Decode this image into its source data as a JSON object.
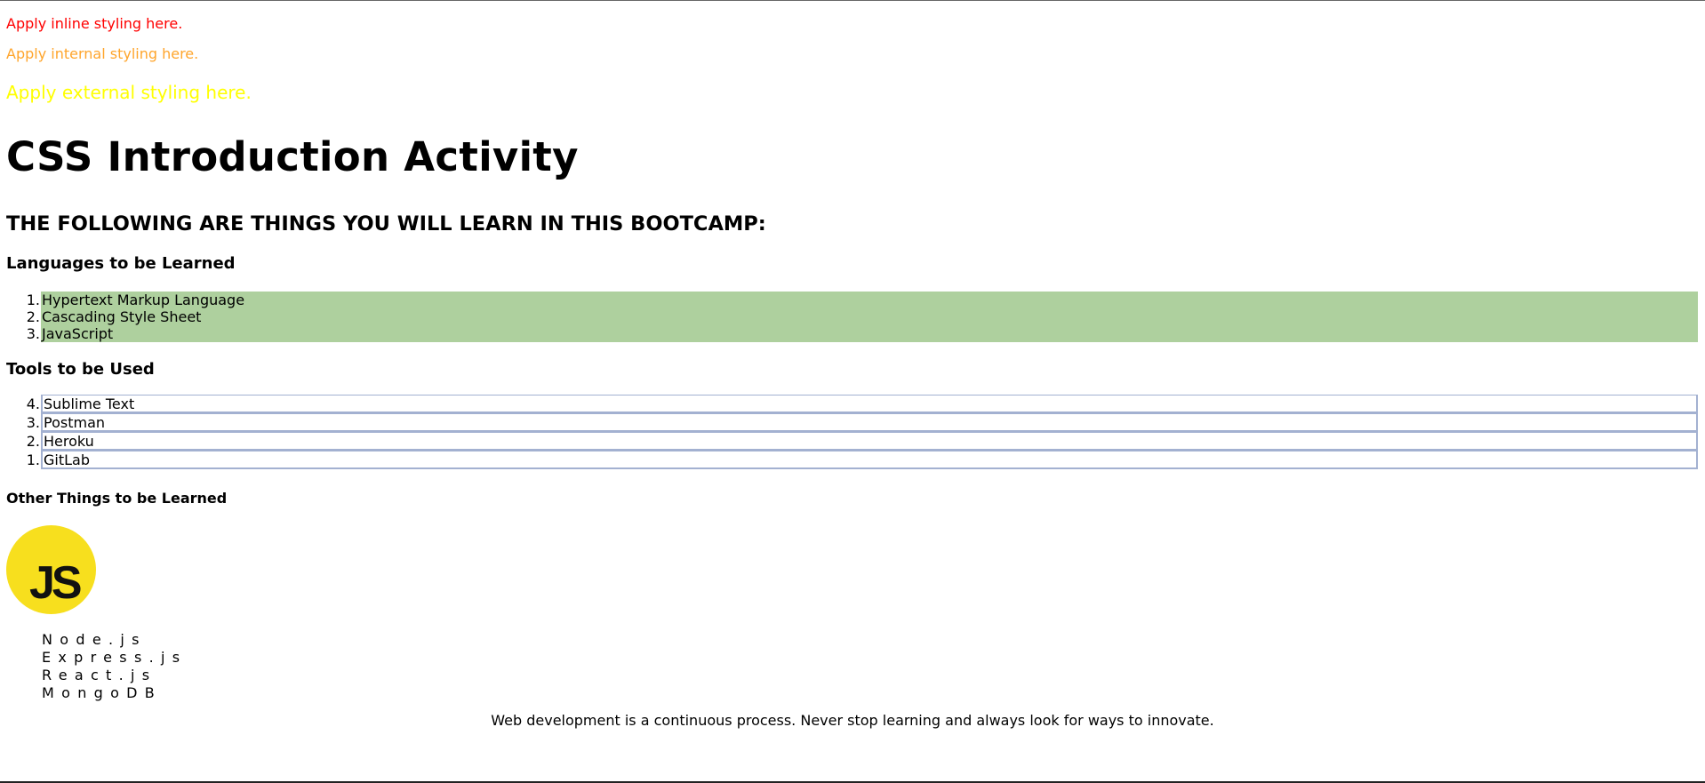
{
  "styling_lines": {
    "inline": "Apply inline styling here.",
    "internal": "Apply internal styling here.",
    "external": "Apply external styling here."
  },
  "title": "CSS Introduction Activity",
  "subtitle": "THE FOLLOWING ARE THINGS YOU WILL LEARN IN THIS BOOTCAMP:",
  "languages": {
    "heading": "Languages to be Learned",
    "items": [
      {
        "num": "1.",
        "label": "Hypertext Markup Language"
      },
      {
        "num": "2.",
        "label": "Cascading Style Sheet"
      },
      {
        "num": "3.",
        "label": "JavaScript"
      }
    ]
  },
  "tools": {
    "heading": "Tools to be Used",
    "items": [
      {
        "num": "4.",
        "label": "Sublime Text"
      },
      {
        "num": "3.",
        "label": "Postman"
      },
      {
        "num": "2.",
        "label": "Heroku"
      },
      {
        "num": "1.",
        "label": "GitLab"
      }
    ]
  },
  "other": {
    "heading": "Other Things to be Learned",
    "logo_text": "JS",
    "items": [
      "Node.js",
      "Express.js",
      "React.js",
      "MongoDB"
    ]
  },
  "footer": "Web development is a continuous process. Never stop learning and always look for ways to innovate.",
  "colors": {
    "inline": "#ff0000",
    "internal": "#ffa52c",
    "external": "#ffff00",
    "highlight": "#aed09e",
    "logo": "#f7df1e"
  }
}
